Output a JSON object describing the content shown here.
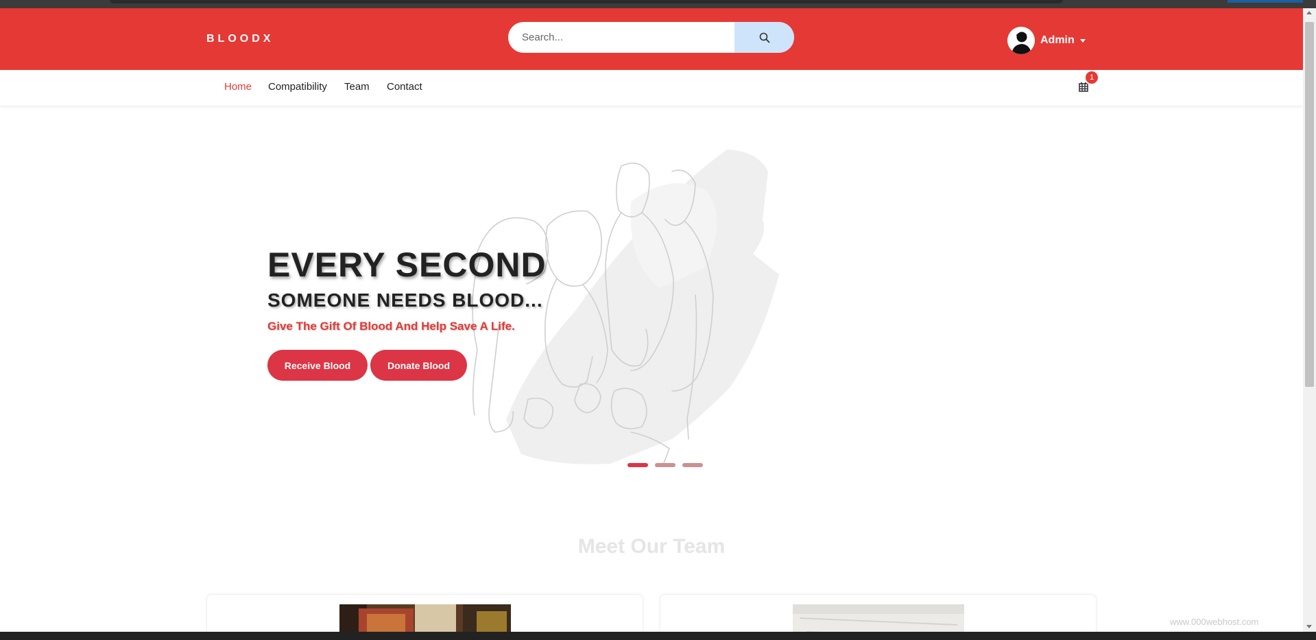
{
  "header": {
    "brand": "BLOODX",
    "search": {
      "placeholder": "Search..."
    },
    "user": {
      "name": "Admin"
    }
  },
  "nav": {
    "items": [
      {
        "label": "Home",
        "active": true
      },
      {
        "label": "Compatibility"
      },
      {
        "label": "Team"
      },
      {
        "label": "Contact"
      }
    ],
    "cart_count": "1"
  },
  "hero": {
    "title": "EVERY SECOND",
    "subtitle": "SOMEONE NEEDS BLOOD...",
    "tagline": "Give The Gift Of Blood And Help Save A Life.",
    "buttons": {
      "receive": "Receive Blood",
      "donate": "Donate Blood"
    },
    "carousel": {
      "slides": 3,
      "active": 1
    }
  },
  "team": {
    "title": "Meet Our Team"
  },
  "footer": {
    "watermark": "www.000webhost.com"
  },
  "colors": {
    "primary": "#e53935",
    "button": "#dc3545",
    "search_button": "#cde4fb"
  }
}
